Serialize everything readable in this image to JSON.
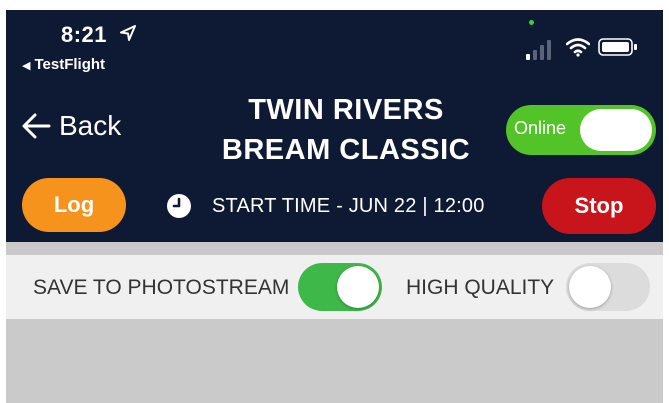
{
  "status_bar": {
    "time": "8:21",
    "back_app": "TestFlight",
    "location_icon": "location-arrow-icon",
    "signal_icon": "cellular-signal-icon",
    "wifi_icon": "wifi-icon",
    "battery_icon": "battery-icon"
  },
  "nav": {
    "back_label": "Back",
    "title_line1": "TWIN RIVERS",
    "title_line2": "BREAM CLASSIC",
    "online_label": "Online",
    "online_on": true
  },
  "actions": {
    "log_label": "Log",
    "start_time": "START TIME - JUN 22 | 12:00",
    "stop_label": "Stop",
    "clock_icon": "clock-icon"
  },
  "settings": {
    "save_photostream_label": "SAVE TO PHOTOSTREAM",
    "save_photostream_on": true,
    "high_quality_label": "HIGH QUALITY",
    "high_quality_on": false
  },
  "colors": {
    "header_bg": "#0e1a33",
    "online_green": "#53c427",
    "log_orange": "#f6931d",
    "stop_red": "#c8151b",
    "toggle_green": "#3fb84a",
    "settings_bg": "#f0f0f0"
  }
}
